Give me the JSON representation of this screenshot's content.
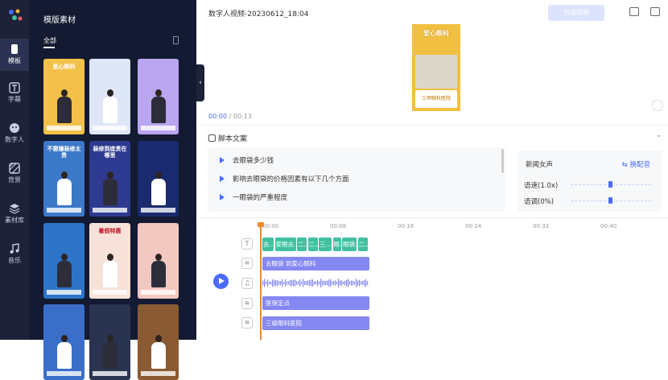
{
  "rail": [
    {
      "label": "模板",
      "icon": "template-icon",
      "active": true
    },
    {
      "label": "字幕",
      "icon": "subtitle-icon"
    },
    {
      "label": "数字人",
      "icon": "digital-human-icon"
    },
    {
      "label": "背景",
      "icon": "background-icon"
    },
    {
      "label": "素材库",
      "icon": "library-icon"
    },
    {
      "label": "音乐",
      "icon": "music-icon"
    }
  ],
  "panel": {
    "title": "模版素材",
    "tab": "全部",
    "thumbs": [
      {
        "caption": "爱心眼科",
        "bg": "#f3c14a",
        "fg": "#ffffff"
      },
      {
        "caption": "",
        "bg": "#dfe6f7",
        "fg": "#2a3a8a"
      },
      {
        "caption": "",
        "bg": "#b9a5f0",
        "fg": "#ffffff"
      },
      {
        "caption": "不要嫌装修太贵",
        "bg": "#3c78c8",
        "fg": "#ffffff"
      },
      {
        "caption": "装修到底贵在哪里",
        "bg": "#2e3a8f",
        "fg": "#ffffff"
      },
      {
        "caption": "",
        "bg": "#1a2a6e",
        "fg": "#f1c040"
      },
      {
        "caption": "",
        "bg": "#2d74c9",
        "fg": "#ffffff"
      },
      {
        "caption": "暑假特惠",
        "bg": "#f6e2d8",
        "fg": "#c0182a"
      },
      {
        "caption": "",
        "bg": "#f3c8c0",
        "fg": "#ffffff"
      },
      {
        "caption": "",
        "bg": "#3a6ec8",
        "fg": "#ffffff"
      },
      {
        "caption": "",
        "bg": "#2a3450",
        "fg": "#ffffff"
      },
      {
        "caption": "",
        "bg": "#8a5a32",
        "fg": "#ffffff"
      }
    ]
  },
  "header": {
    "project_title": "数字人视频-20230612_18:04",
    "synth_button": "合成视频"
  },
  "preview": {
    "caption": "爱心眼科",
    "box_text": "三甲眼科医院"
  },
  "timecode": {
    "current": "00:00",
    "sep": "/",
    "total": "00:13"
  },
  "script": {
    "title": "脚本文案",
    "lines": [
      "去眼袋多少钱",
      "影响去眼袋的价格因素有以下几个方面",
      "一眼袋的严重程度"
    ]
  },
  "voice": {
    "name": "新闻女声",
    "switch_label": "换配音",
    "speed_label": "语速(1.0x)",
    "speed_value": 0.5,
    "pitch_label": "语调(0%)",
    "pitch_value": 0.5
  },
  "ruler": [
    "00:00",
    "00:08",
    "00:16",
    "00:24",
    "00:32",
    "00:40"
  ],
  "tracks": {
    "subtitle_segments": [
      "去...",
      "爱眼去...",
      "二...",
      "二...",
      "三...",
      "眼...",
      "眼袋...",
      "二..."
    ],
    "segments": [
      "去眼袋 到爱心眼科",
      "医保定点",
      "三级眼科医院"
    ]
  },
  "colors": {
    "accent": "#4d6bfe",
    "subtitle_segment": "#41c19f",
    "media_segment": "#8587f2",
    "playhead": "#f08a24"
  }
}
